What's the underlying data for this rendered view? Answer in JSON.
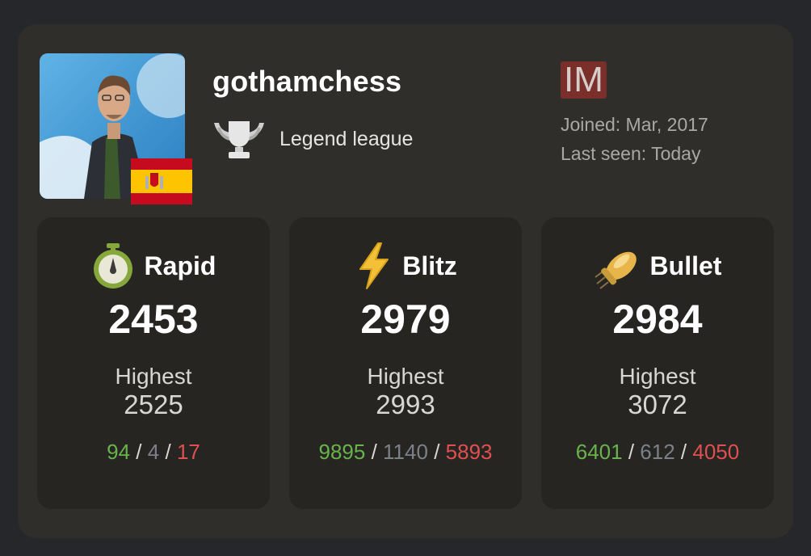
{
  "profile": {
    "username": "gothamchess",
    "league": "Legend league",
    "title_badge": "IM",
    "joined": "Joined: Mar, 2017",
    "last_seen": "Last seen: Today",
    "country": "Spain"
  },
  "colors": {
    "win": "#69b34c",
    "draw": "#7c8088",
    "loss": "#e05050",
    "badge": "#7a2f2b"
  },
  "stats": [
    {
      "name": "Rapid",
      "icon": "stopwatch-icon",
      "rating": "2453",
      "highest_label": "Highest",
      "highest": "2525",
      "wins": "94",
      "draws": "4",
      "losses": "17",
      "sep": "/"
    },
    {
      "name": "Blitz",
      "icon": "lightning-icon",
      "rating": "2979",
      "highest_label": "Highest",
      "highest": "2993",
      "wins": "9895",
      "draws": "1140",
      "losses": "5893",
      "sep": "/"
    },
    {
      "name": "Bullet",
      "icon": "bullet-icon",
      "rating": "2984",
      "highest_label": "Highest",
      "highest": "3072",
      "wins": "6401",
      "draws": "612",
      "losses": "4050",
      "sep": "/"
    }
  ]
}
